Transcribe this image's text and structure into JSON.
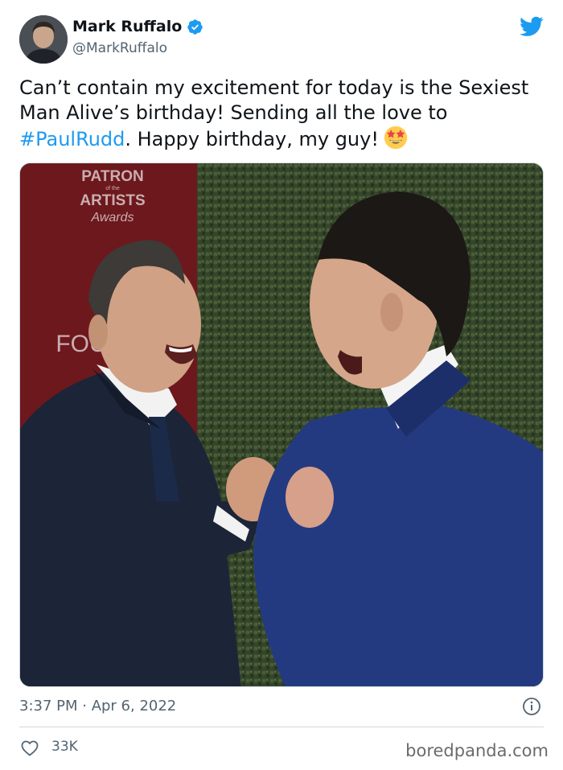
{
  "author": {
    "display_name": "Mark Ruffalo",
    "handle": "@MarkRuffalo",
    "verified": true
  },
  "tweet": {
    "text_part1": "Can’t contain my excitement for today is the Sexiest Man Alive’s birthday! Sending all the love to ",
    "hashtag": "#PaulRudd",
    "text_part2": ". Happy birthday, my guy!",
    "emoji": "star-struck-emoji"
  },
  "photo": {
    "backdrop_sign": {
      "line1": "PATRON",
      "line2": "of the",
      "line3": "ARTISTS",
      "line4": "Awards",
      "partial": "FOU"
    }
  },
  "meta": {
    "timestamp": "3:37 PM · Apr 6, 2022"
  },
  "actions": {
    "like_count": "33K"
  },
  "watermark": "boredpanda.com",
  "colors": {
    "accent": "#1d9bf0",
    "secondary_text": "#536471",
    "primary_text": "#0f1419"
  }
}
